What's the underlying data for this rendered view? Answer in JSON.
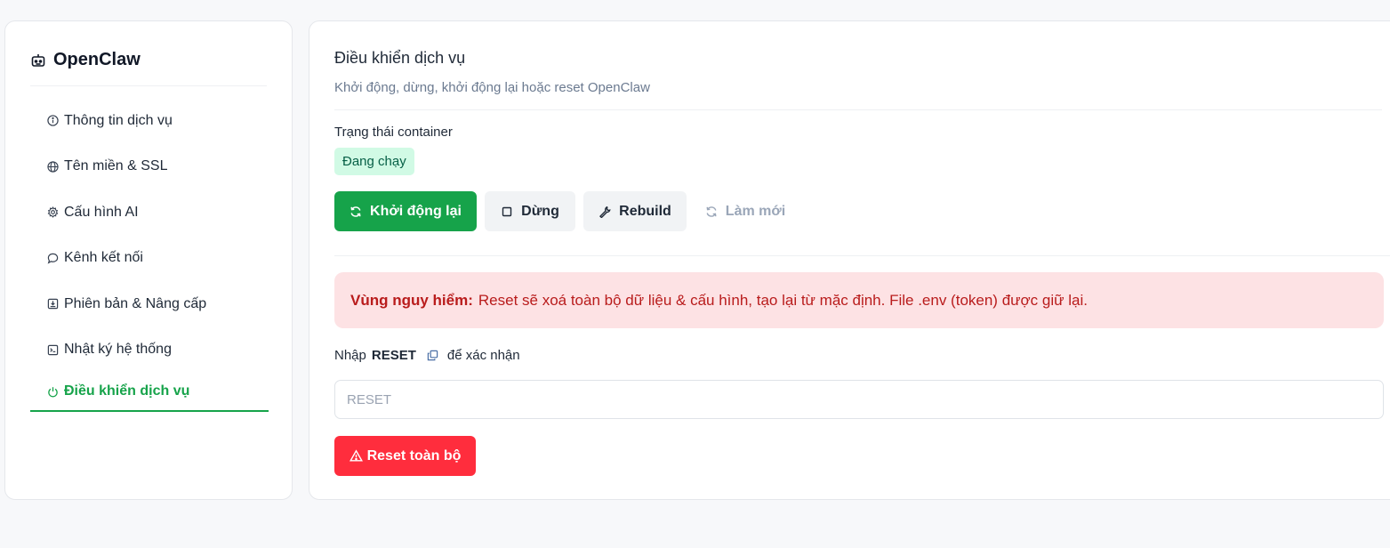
{
  "sidebar": {
    "brand": {
      "icon": "robot-icon",
      "name": "OpenClaw"
    },
    "items": [
      {
        "icon": "info-icon",
        "label": "Thông tin dịch vụ"
      },
      {
        "icon": "globe-icon",
        "label": "Tên miền & SSL"
      },
      {
        "icon": "gear-icon",
        "label": "Cấu hình AI"
      },
      {
        "icon": "chat-bubble-icon",
        "label": "Kênh kết nối"
      },
      {
        "icon": "download-box-icon",
        "label": "Phiên bản & Nâng cấp"
      },
      {
        "icon": "terminal-icon",
        "label": "Nhật ký hệ thống"
      },
      {
        "icon": "power-icon",
        "label": "Điều khiển dịch vụ",
        "active": true
      }
    ]
  },
  "main": {
    "title": "Điều khiển dịch vụ",
    "subtitle": "Khởi động, dừng, khởi động lại hoặc reset OpenClaw",
    "status": {
      "label": "Trạng thái container",
      "badge": "Đang chạy"
    },
    "actions": {
      "restart": "Khởi động lại",
      "stop": "Dừng",
      "rebuild": "Rebuild",
      "refresh": "Làm mới"
    },
    "danger": {
      "title": "Vùng nguy hiểm:",
      "message": "Reset sẽ xoá toàn bộ dữ liệu & cấu hình, tạo lại từ mặc định. File .env (token) được giữ lại."
    },
    "confirm": {
      "prefix": "Nhập",
      "keyword": "RESET",
      "suffix": "để xác nhận",
      "input_placeholder": "RESET",
      "input_value": ""
    },
    "reset_button": "Reset toàn bộ"
  },
  "colors": {
    "accent": "#16a34a",
    "status_badge_bg": "#d1fae5",
    "danger_bg": "#fde2e4",
    "danger_text": "#b91c1c",
    "reset_button": "#ff2d3d"
  }
}
